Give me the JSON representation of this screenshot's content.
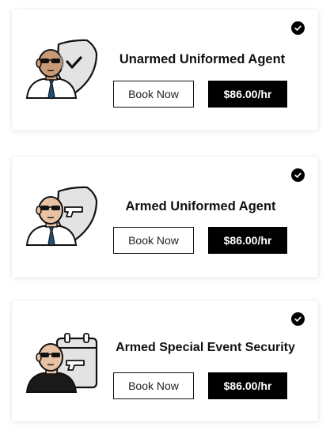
{
  "services": [
    {
      "title": "Unarmed Uniformed Agent",
      "book_label": "Book Now",
      "price_label": "$86.00/hr",
      "illustration": "guard-with-shield-check-icon",
      "selected": true
    },
    {
      "title": "Armed Uniformed Agent",
      "book_label": "Book Now",
      "price_label": "$86.00/hr",
      "illustration": "guard-with-shield-gun-icon",
      "selected": true
    },
    {
      "title": "Armed Special Event Security",
      "book_label": "Book Now",
      "price_label": "$86.00/hr",
      "illustration": "guard-with-calendar-gun-icon",
      "selected": true
    }
  ],
  "colors": {
    "accent": "#000000",
    "skin": "#c99a75",
    "shield": "#e3e3e3",
    "tie": "#1f4e79"
  }
}
